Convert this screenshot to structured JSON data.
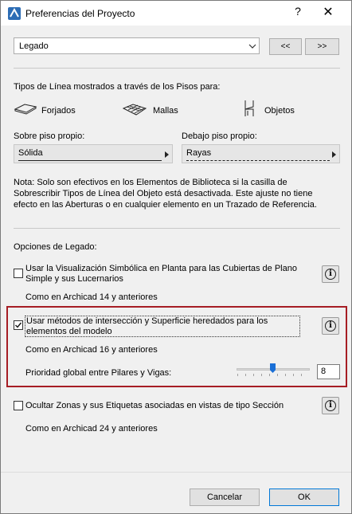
{
  "window": {
    "title": "Preferencias del Proyecto",
    "help_glyph": "?",
    "close_glyph": "✕"
  },
  "preset": {
    "value": "Legado",
    "prev_label": "<<",
    "next_label": ">>"
  },
  "linetypes": {
    "heading": "Tipos de Línea mostrados a través de los Pisos para:",
    "items": [
      {
        "label": "Forjados",
        "icon": "slab-icon"
      },
      {
        "label": "Mallas",
        "icon": "mesh-icon"
      },
      {
        "label": "Objetos",
        "icon": "object-chair-icon"
      }
    ],
    "own_floor": {
      "label": "Sobre piso propio:",
      "value": "Sólida"
    },
    "below_floor": {
      "label": "Debajo piso propio:",
      "value": "Rayas"
    },
    "note": [
      "Nota: Solo son efectivos en los Elementos de Biblioteca si la casilla de",
      "Sobrescribir Tipos de Línea del Objeto está desactivada. Este ajuste no tiene",
      "efecto en las Aberturas o en cualquier elemento en un Trazado de Referencia."
    ]
  },
  "legacy": {
    "heading": "Opciones de Legado:",
    "options": [
      {
        "lines": [
          "Usar la Visualización Simbólica en Planta para las Cubiertas de Plano",
          "Simple y sus Lucernarios"
        ],
        "note": "Como en Archicad 14 y anteriores",
        "checked": false
      },
      {
        "lines": [
          "Usar métodos de intersección y Superficie heredados para los",
          "elementos del modelo"
        ],
        "note": "Como en Archicad 16 y anteriores",
        "checked": true
      },
      {
        "lines": [
          "Ocultar Zonas y sus Etiquetas asociadas en vistas de tipo Sección"
        ],
        "note": "Como en Archicad 24 y anteriores",
        "checked": false
      }
    ],
    "priority": {
      "label": "Prioridad global entre Pilares y Vigas:",
      "value": "8",
      "slider_fraction": 0.53
    },
    "info_glyph": "i"
  },
  "footer": {
    "cancel_label": "Cancelar",
    "ok_label": "OK"
  },
  "colors": {
    "highlight": "#a61d24",
    "slider_thumb": "#1a6fd6"
  }
}
